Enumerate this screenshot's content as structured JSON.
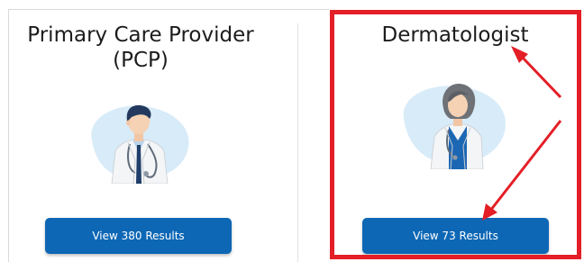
{
  "cards": [
    {
      "title": "Primary Care Provider (PCP)",
      "button_label": "View 380 Results",
      "illustration": "male-doctor-illustration"
    },
    {
      "title": "Dermatologist",
      "button_label": "View 73 Results",
      "illustration": "female-doctor-illustration"
    }
  ],
  "colors": {
    "button": "#0d67b5",
    "highlight": "#e41e26",
    "blob": "#d8ebf8"
  }
}
